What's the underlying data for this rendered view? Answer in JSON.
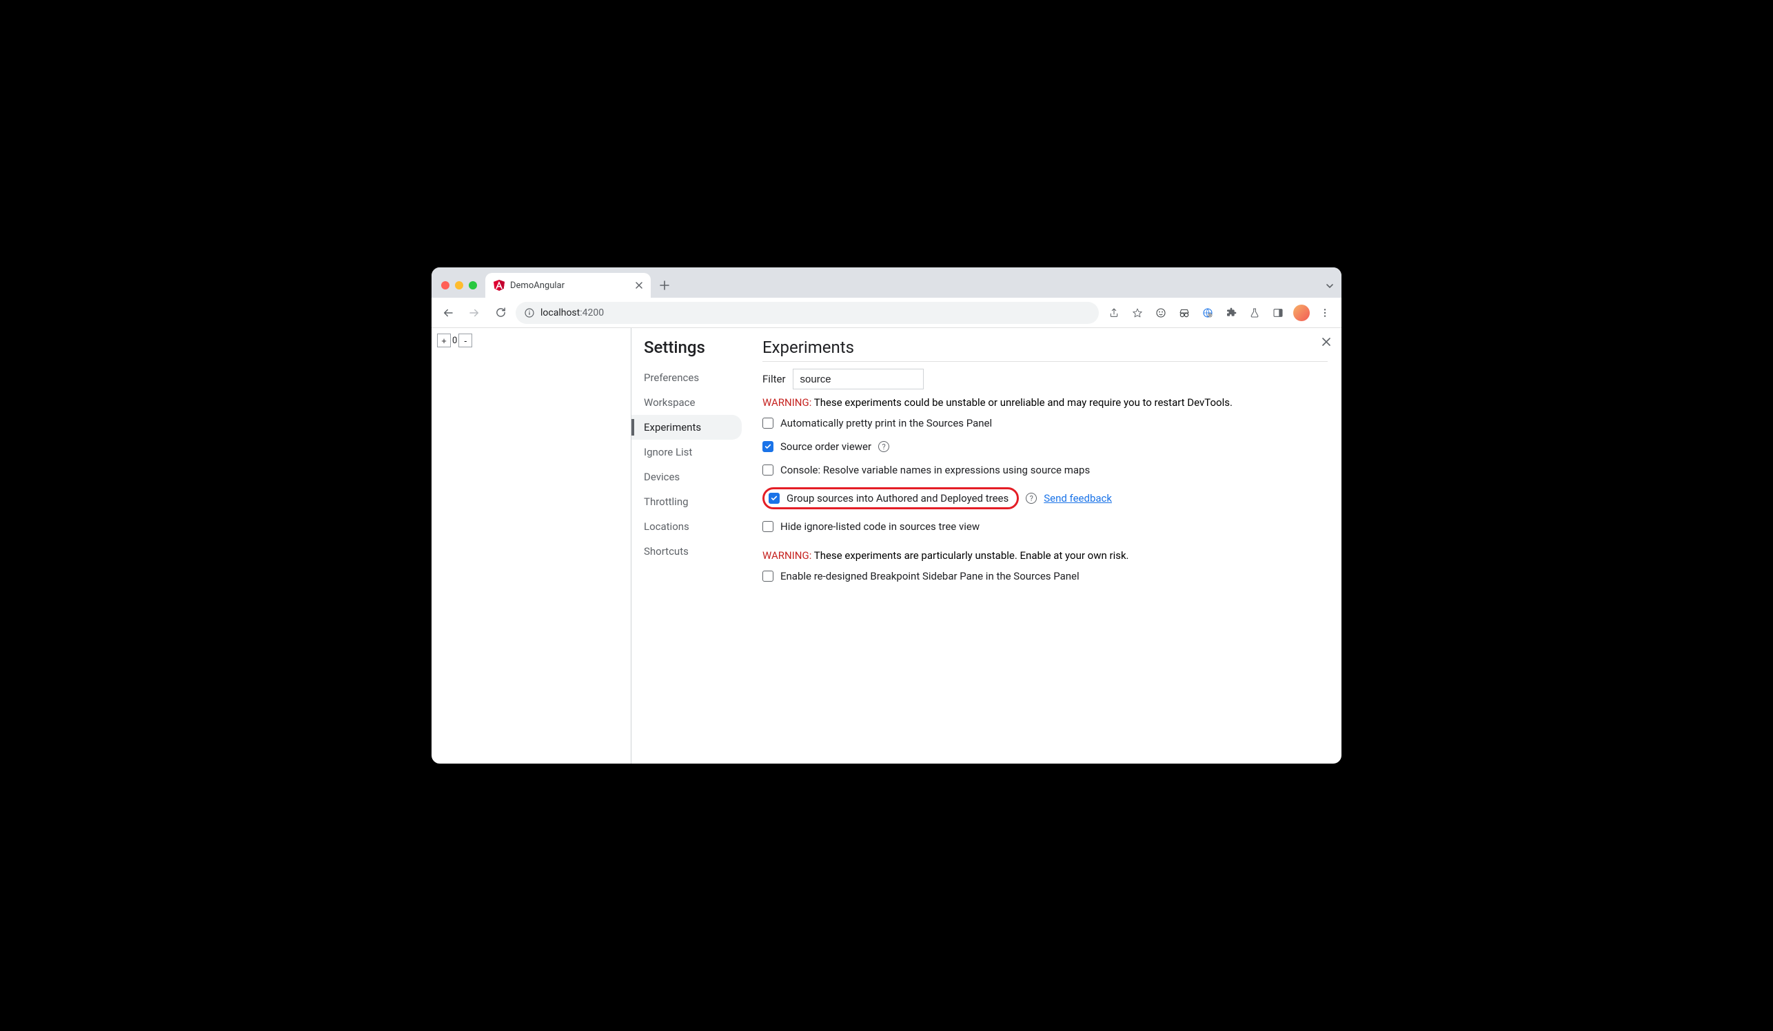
{
  "browser": {
    "tab_title": "DemoAngular",
    "url_host": "localhost",
    "url_port": ":4200"
  },
  "leftpane": {
    "counter_value": "0"
  },
  "settings": {
    "title": "Settings",
    "items": [
      {
        "label": "Preferences"
      },
      {
        "label": "Workspace"
      },
      {
        "label": "Experiments"
      },
      {
        "label": "Ignore List"
      },
      {
        "label": "Devices"
      },
      {
        "label": "Throttling"
      },
      {
        "label": "Locations"
      },
      {
        "label": "Shortcuts"
      }
    ],
    "active_index": 2
  },
  "experiments": {
    "title": "Experiments",
    "filter_label": "Filter",
    "filter_value": "source",
    "warning1_tag": "WARNING:",
    "warning1_text": " These experiments could be unstable or unreliable and may require you to restart DevTools.",
    "warning2_tag": "WARNING:",
    "warning2_text": " These experiments are particularly unstable. Enable at your own risk.",
    "feedback_link": "Send feedback",
    "items": [
      {
        "label": "Automatically pretty print in the Sources Panel",
        "checked": false,
        "help": false
      },
      {
        "label": "Source order viewer",
        "checked": true,
        "help": true
      },
      {
        "label": "Console: Resolve variable names in expressions using source maps",
        "checked": false,
        "help": false
      },
      {
        "label": "Group sources into Authored and Deployed trees",
        "checked": true,
        "help": true,
        "highlight": true,
        "feedback": true
      },
      {
        "label": "Hide ignore-listed code in sources tree view",
        "checked": false,
        "help": false
      }
    ],
    "unstable_items": [
      {
        "label": "Enable re-designed Breakpoint Sidebar Pane in the Sources Panel",
        "checked": false
      }
    ]
  }
}
